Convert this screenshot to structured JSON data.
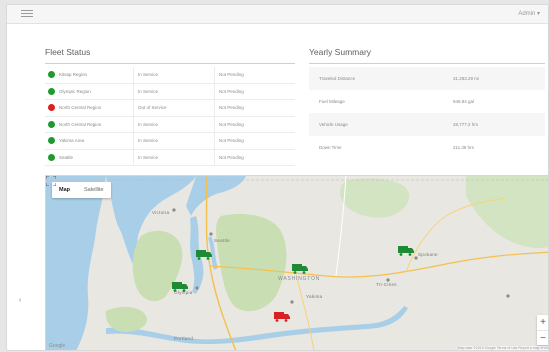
{
  "topbar": {
    "user_label": "Admin ▾"
  },
  "fleet_status": {
    "title": "Fleet Status",
    "rows": [
      {
        "name": "Kitsap Region",
        "status": "In Service",
        "maintenance": "Not Pending",
        "color": "#1f9a2e"
      },
      {
        "name": "Olympic Region",
        "status": "In Service",
        "maintenance": "Not Pending",
        "color": "#1f9a2e"
      },
      {
        "name": "North Central Region",
        "status": "Out of Service",
        "maintenance": "Not Pending",
        "color": "#d62222"
      },
      {
        "name": "North Central Region",
        "status": "In Service",
        "maintenance": "Not Pending",
        "color": "#1f9a2e"
      },
      {
        "name": "Yakima Area",
        "status": "In Service",
        "maintenance": "Not Pending",
        "color": "#1f9a2e"
      },
      {
        "name": "Seattle",
        "status": "In Service",
        "maintenance": "Not Pending",
        "color": "#1f9a2e"
      }
    ]
  },
  "yearly_summary": {
    "title": "Yearly Summary",
    "rows": [
      {
        "label": "Traveled Distance",
        "value": "31,283.29 mi"
      },
      {
        "label": "Fuel Mileage",
        "value": "948.84 gal"
      },
      {
        "label": "Vehicle Usage",
        "value": "28,777.2 hrs"
      },
      {
        "label": "Down Time",
        "value": "211.38 hrs"
      }
    ]
  },
  "map": {
    "map_label": "Map",
    "satellite_label": "Satellite",
    "zoom_in": "+",
    "zoom_out": "−",
    "google_label": "Google",
    "attribution": "Map data ©2019 Google   Terms of Use   Report a map error",
    "labels": {
      "victoria": "Victoria",
      "seattle": "Seattle",
      "washington": "WASHINGTON",
      "yakima": "Yakima",
      "spokane": "Spokane",
      "olympia": "Olympia",
      "portland": "Portland",
      "tricities": "Tri-Cities"
    },
    "trucks": [
      {
        "id": "olympic",
        "color": "#1f8a35",
        "status": "ok"
      },
      {
        "id": "kitsap",
        "color": "#1f8a35",
        "status": "ok"
      },
      {
        "id": "central",
        "color": "#1f8a35",
        "status": "ok"
      },
      {
        "id": "spokane",
        "color": "#1f8a35",
        "status": "ok"
      },
      {
        "id": "north-central",
        "color": "#d62222",
        "status": "out"
      }
    ]
  },
  "colors": {
    "in_service": "#1f9a2e",
    "out_of_service": "#d62222",
    "water": "#a9cfe8",
    "land": "#e9e7e1",
    "forest": "#c9dfb3"
  }
}
